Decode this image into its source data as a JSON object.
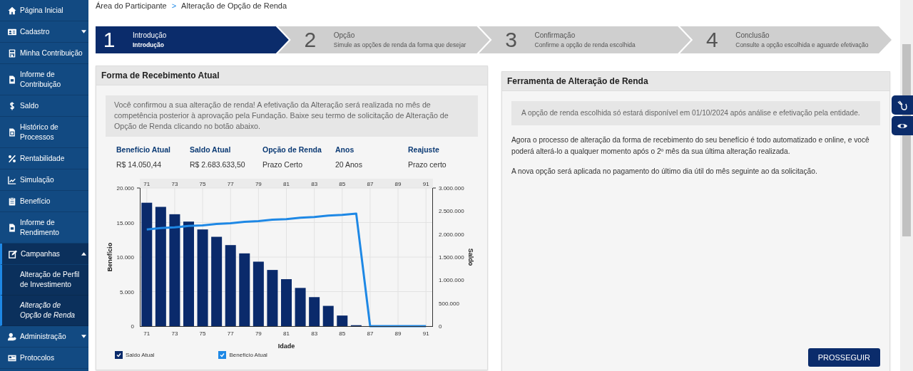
{
  "sidebar": {
    "items": [
      {
        "label": "Página Inicial",
        "kind": "link",
        "selected": false
      },
      {
        "label": "Cadastro",
        "kind": "menu",
        "expanded": false,
        "selected": false
      },
      {
        "label": "Minha Contribuição",
        "kind": "link",
        "selected": false
      },
      {
        "label": "Informe de Contribuição",
        "kind": "link",
        "selected": false
      },
      {
        "label": "Saldo",
        "kind": "link",
        "selected": false
      },
      {
        "label": "Histórico de Processos",
        "kind": "link",
        "selected": false
      },
      {
        "label": "Rentabilidade",
        "kind": "link",
        "selected": false
      },
      {
        "label": "Simulação",
        "kind": "link",
        "selected": false
      },
      {
        "label": "Benefício",
        "kind": "link",
        "selected": false
      },
      {
        "label": "Informe de Rendimento",
        "kind": "link",
        "selected": false
      },
      {
        "label": "Campanhas",
        "kind": "menu",
        "expanded": true,
        "selected": true,
        "children": [
          {
            "label": "Alteração de Perfil de Investimento",
            "selected": false
          },
          {
            "label": "Alteração de Opção de Renda",
            "selected": true
          }
        ]
      },
      {
        "label": "Administração",
        "kind": "menu",
        "expanded": false,
        "selected": false
      },
      {
        "label": "Protocolos",
        "kind": "link",
        "selected": false
      }
    ]
  },
  "breadcrumb": {
    "items": [
      "Área do Participante",
      "Alteração de Opção de Renda"
    ],
    "separator": ">"
  },
  "steps": [
    {
      "number": "1",
      "title": "Introdução",
      "subtitle": "Introdução",
      "selected": true
    },
    {
      "number": "2",
      "title": "Opção",
      "subtitle": "Simule as opções de renda da forma que desejar",
      "selected": false
    },
    {
      "number": "3",
      "title": "Confirmação",
      "subtitle": "Confirme a opção de renda escolhida",
      "selected": false
    },
    {
      "number": "4",
      "title": "Conclusão",
      "subtitle": "Consulte a opção escolhida e aguarde efetivação",
      "selected": false
    }
  ],
  "current_card": {
    "title": "Forma de Recebimento Atual",
    "notice": "Você confirmou a sua alteração de renda! A efetivação da Alteração será realizada no mês de competência posterior à aprovação pela Fundação. Baixe seu termo de solicitação de Alteração de Opção de Renda clicando no botão abaixo.",
    "summary": [
      {
        "label": "Benefício Atual",
        "value": "R$ 14.050,44"
      },
      {
        "label": "Saldo Atual",
        "value": "R$ 2.683.633,50"
      },
      {
        "label": "Opção de Renda",
        "value": "Prazo Certo"
      },
      {
        "label": "Anos",
        "value": "20 Anos"
      },
      {
        "label": "Reajuste",
        "value": "Prazo certo"
      }
    ],
    "chart_data": {
      "type": "bar",
      "xlabel": "Idade",
      "ylabel": "Benefício",
      "y2label": "Saldo",
      "x": [
        71,
        72,
        73,
        74,
        75,
        76,
        77,
        78,
        79,
        80,
        81,
        82,
        83,
        84,
        85,
        86,
        87,
        88,
        89,
        90,
        91
      ],
      "xlim": [
        70.5,
        91.5
      ],
      "xticks": [
        {
          "value": 71,
          "label": "71"
        },
        {
          "value": 73,
          "label": "73"
        },
        {
          "value": 75,
          "label": "75"
        },
        {
          "value": 77,
          "label": "77"
        },
        {
          "value": 79,
          "label": "79"
        },
        {
          "value": 81,
          "label": "81"
        },
        {
          "value": 83,
          "label": "83"
        },
        {
          "value": 85,
          "label": "85"
        },
        {
          "value": 87,
          "label": "87"
        },
        {
          "value": 89,
          "label": "89"
        },
        {
          "value": 91,
          "label": "91"
        }
      ],
      "grid": true,
      "legend": "bottom",
      "ylim": [
        0,
        20000
      ],
      "yticks": [
        {
          "value": 0,
          "label": "0"
        },
        {
          "value": 5000,
          "label": "5.000"
        },
        {
          "value": 10000,
          "label": "10.000"
        },
        {
          "value": 15000,
          "label": "15.000"
        },
        {
          "value": 20000,
          "label": "20.000"
        }
      ],
      "y2lim": [
        0,
        3000000
      ],
      "y2ticks": [
        {
          "value": 0,
          "label": "0"
        },
        {
          "value": 500000,
          "label": "500.000"
        },
        {
          "value": 1000000,
          "label": "1.000.000"
        },
        {
          "value": 1500000,
          "label": "1.500.000"
        },
        {
          "value": 2000000,
          "label": "2.000.000"
        },
        {
          "value": 2500000,
          "label": "2.500.000"
        },
        {
          "value": 3000000,
          "label": "3.000.000"
        }
      ],
      "series": [
        {
          "name": "Saldo Atual",
          "type": "bar",
          "axis": "y2",
          "color": "#0a2a6b",
          "values": [
            2680000,
            2590000,
            2430000,
            2270000,
            2100000,
            1940000,
            1760000,
            1580000,
            1400000,
            1220000,
            1020000,
            830000,
            630000,
            440000,
            230000,
            20000,
            0,
            0,
            0,
            0,
            0
          ]
        },
        {
          "name": "Benefício Atual",
          "type": "line",
          "color": "#1e88e5",
          "values": [
            14000,
            14200,
            14300,
            14500,
            14600,
            14800,
            14900,
            15100,
            15200,
            15400,
            15500,
            15700,
            15800,
            16000,
            16100,
            16300,
            0,
            0,
            0,
            0,
            0
          ]
        }
      ]
    },
    "top_axis_labels": [
      "71",
      "73",
      "75",
      "77",
      "79",
      "81",
      "83",
      "85",
      "87",
      "89",
      "91"
    ],
    "legend_checkboxes": [
      {
        "checked": true
      },
      {
        "checked": true
      }
    ]
  },
  "tool_card": {
    "title": "Ferramenta de Alteração de Renda",
    "notice": "A opção de renda escolhida só estará disponível em 01/10/2024 após análise e efetivação pela entidade.",
    "paragraphs": [
      "Agora o processo de alteração da forma de recebimento do seu benefício é todo automatizado e online, e você poderá alterá-lo a qualquer momento após o 2º mês da sua última alteração realizada.",
      "A nova opção será aplicada no pagamento do último dia útil do mês seguinte ao da solicitação."
    ],
    "button": "PROSSEGUIR"
  }
}
